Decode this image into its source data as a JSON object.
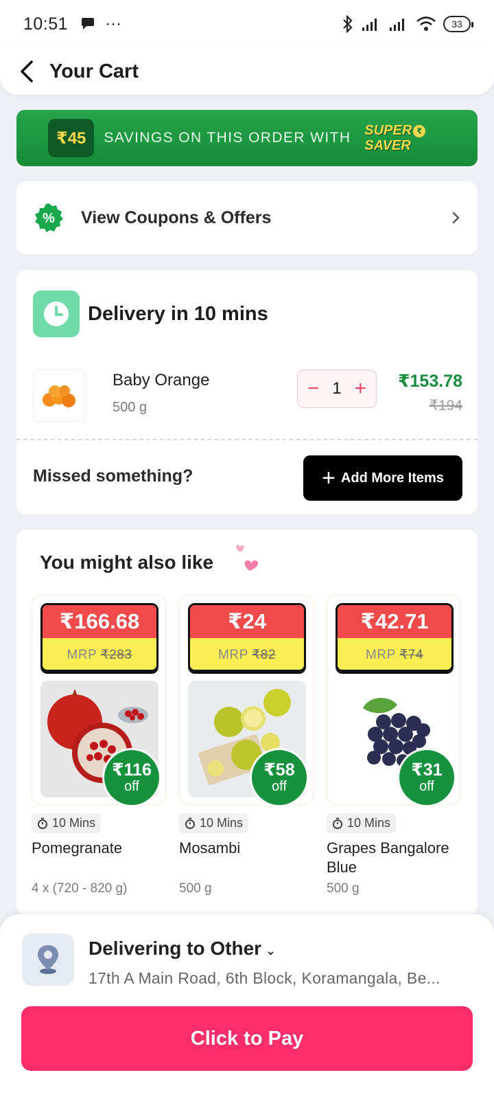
{
  "status_bar": {
    "time": "10:51",
    "dots": "···",
    "battery": "33"
  },
  "header": {
    "title": "Your Cart"
  },
  "savings_banner": {
    "amount": "₹45",
    "text": "SAVINGS ON THIS ORDER WITH",
    "logo_line1": "SUPER",
    "logo_line2": "SAVER",
    "logo_coin": "₹"
  },
  "coupons": {
    "label": "View Coupons & Offers"
  },
  "delivery": {
    "title": "Delivery in 10 mins",
    "item": {
      "name": "Baby Orange",
      "weight": "500 g",
      "quantity": "1",
      "price": "₹153.78",
      "mrp": "₹194"
    },
    "missed_text": "Missed something?",
    "add_more_label": "Add More Items"
  },
  "suggestions": {
    "title": "You might also like",
    "products": [
      {
        "price": "₹166.68",
        "mrp_label": "MRP",
        "mrp": "₹283",
        "off_amount": "₹116",
        "off_word": "off",
        "eta": "10 Mins",
        "name": "Pomegranate",
        "qty": "4 x (720 - 820 g)"
      },
      {
        "price": "₹24",
        "mrp_label": "MRP",
        "mrp": "₹82",
        "off_amount": "₹58",
        "off_word": "off",
        "eta": "10 Mins",
        "name": "Mosambi",
        "qty": "500 g"
      },
      {
        "price": "₹42.71",
        "mrp_label": "MRP",
        "mrp": "₹74",
        "off_amount": "₹31",
        "off_word": "off",
        "eta": "10 Mins",
        "name": "Grapes Bangalore Blue",
        "qty": "500 g"
      }
    ]
  },
  "delivery_location": {
    "title": "Delivering to Other",
    "address": "17th A Main Road, 6th Block, Koramangala, Be..."
  },
  "pay_button": {
    "label": "Click to Pay"
  },
  "colors": {
    "brand_pink": "#ff2d6a",
    "price_green": "#178c3f",
    "banner_green": "#168c38",
    "tag_red": "#f04a4a",
    "tag_yellow": "#f9ef55"
  }
}
